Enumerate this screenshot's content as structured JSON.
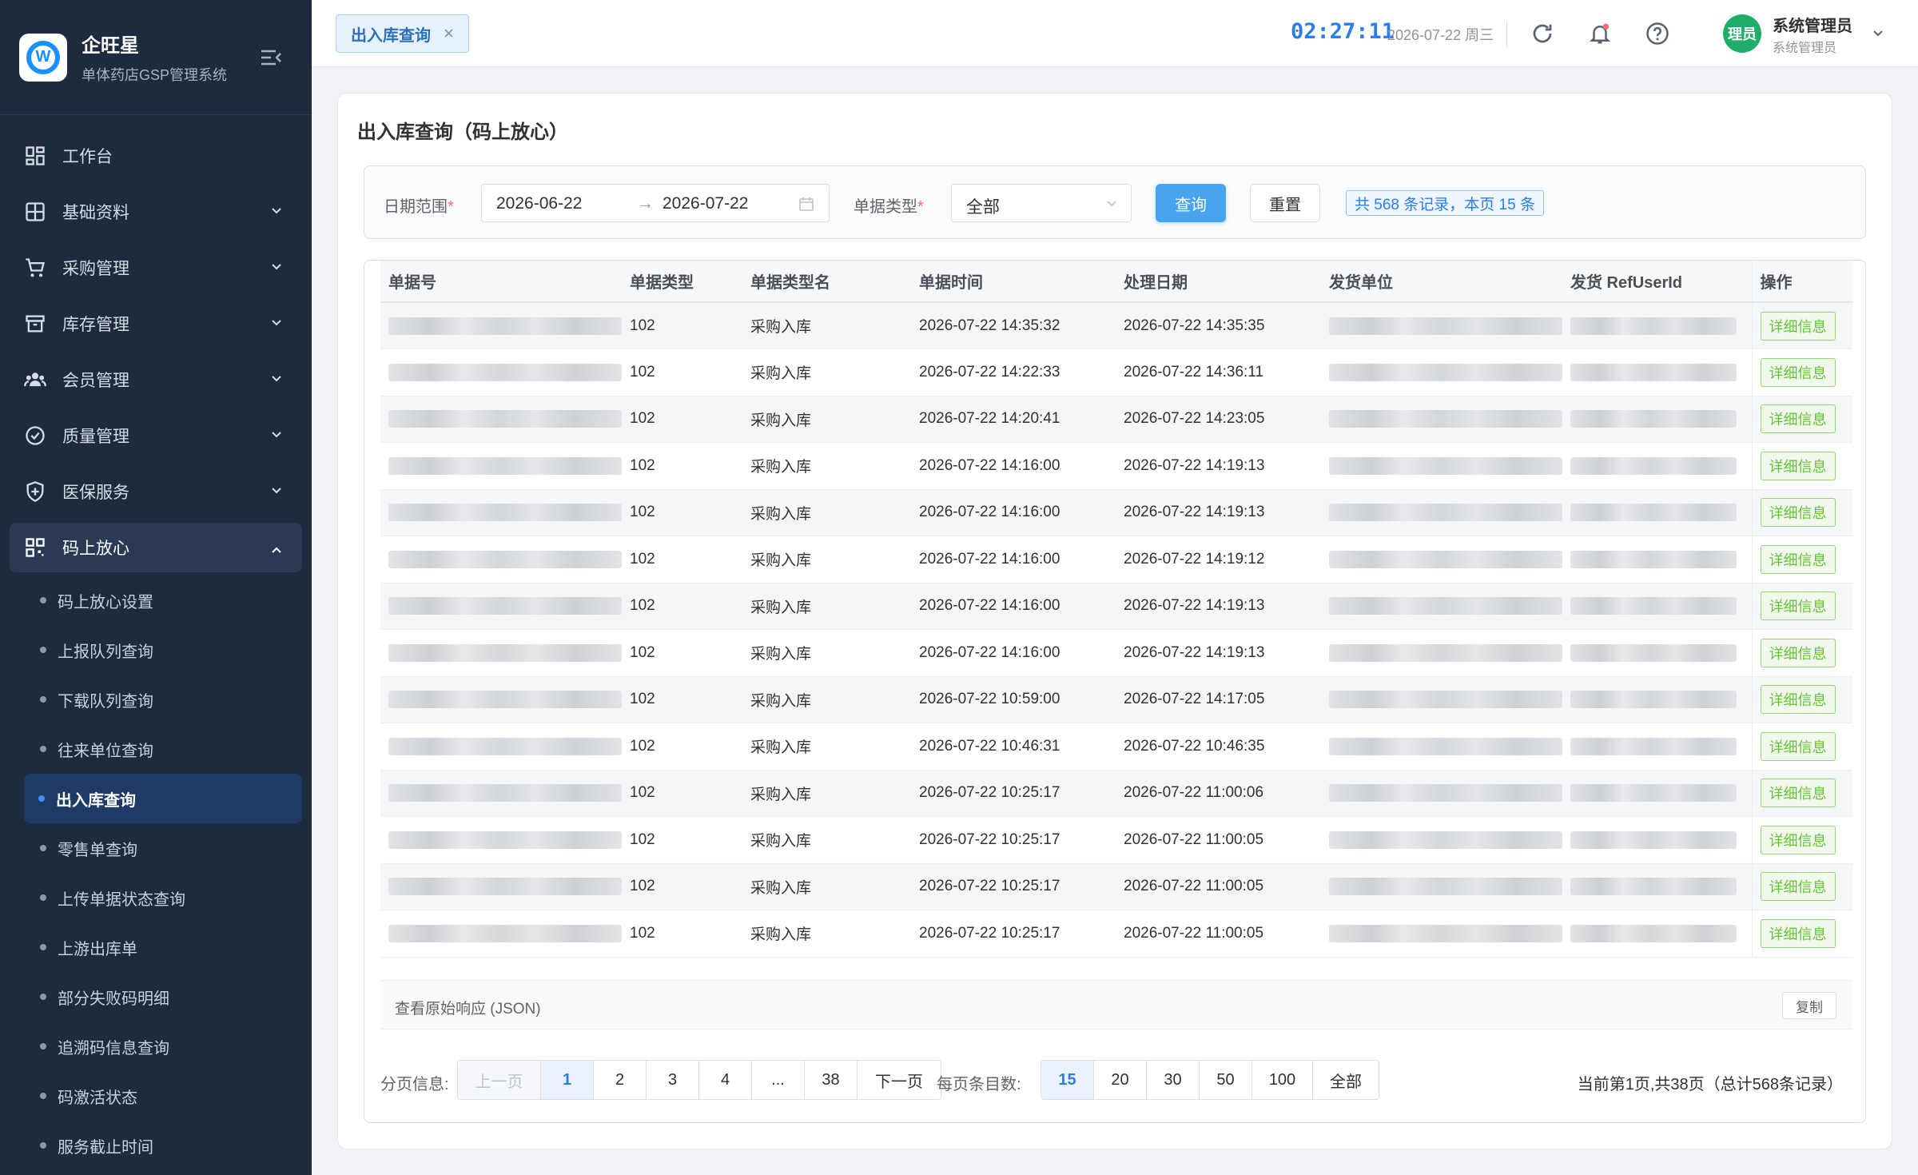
{
  "brand": {
    "name": "企旺星",
    "subtitle": "单体药店GSP管理系统",
    "logo_letter": "W"
  },
  "sidebar": {
    "items": [
      {
        "label": "工作台",
        "icon": "dashboard-icon"
      },
      {
        "label": "基础资料",
        "icon": "grid-icon"
      },
      {
        "label": "采购管理",
        "icon": "cart-icon"
      },
      {
        "label": "库存管理",
        "icon": "box-icon"
      },
      {
        "label": "会员管理",
        "icon": "users-icon"
      },
      {
        "label": "质量管理",
        "icon": "check-circle-icon"
      },
      {
        "label": "医保服务",
        "icon": "shield-icon"
      },
      {
        "label": "码上放心",
        "icon": "qrcode-icon"
      }
    ],
    "subitems": [
      "码上放心设置",
      "上报队列查询",
      "下载队列查询",
      "往来单位查询",
      "出入库查询",
      "零售单查询",
      "上传单据状态查询",
      "上游出库单",
      "部分失败码明细",
      "追溯码信息查询",
      "码激活状态",
      "服务截止时间"
    ]
  },
  "header": {
    "tab_label": "出入库查询",
    "tab_close": "×",
    "clock": "02:27:11",
    "date": "2026-07-22 周三",
    "avatar_text": "理员",
    "user_name": "系统管理员",
    "user_role": "系统管理员"
  },
  "page": {
    "title": "出入库查询（码上放心）"
  },
  "filter": {
    "date_label": "日期范围",
    "required_mark": "*",
    "date_start": "2026-06-22",
    "date_sep": "→",
    "date_end": "2026-07-22",
    "type_label": "单据类型",
    "type_value": "全部",
    "query_btn": "查询",
    "reset_btn": "重置",
    "count_text": "共 568 条记录，本页 15 条"
  },
  "table": {
    "headers": [
      "单据号",
      "单据类型",
      "单据类型名",
      "单据时间",
      "处理日期",
      "发货单位",
      "发货 RefUserId",
      "操作"
    ],
    "detail_label": "详细信息",
    "rows": [
      {
        "type": "102",
        "type_name": "采购入库",
        "time": "2026-07-22 14:35:32",
        "processed": "2026-07-22 14:35:35"
      },
      {
        "type": "102",
        "type_name": "采购入库",
        "time": "2026-07-22 14:22:33",
        "processed": "2026-07-22 14:36:11"
      },
      {
        "type": "102",
        "type_name": "采购入库",
        "time": "2026-07-22 14:20:41",
        "processed": "2026-07-22 14:23:05"
      },
      {
        "type": "102",
        "type_name": "采购入库",
        "time": "2026-07-22 14:16:00",
        "processed": "2026-07-22 14:19:13"
      },
      {
        "type": "102",
        "type_name": "采购入库",
        "time": "2026-07-22 14:16:00",
        "processed": "2026-07-22 14:19:13"
      },
      {
        "type": "102",
        "type_name": "采购入库",
        "time": "2026-07-22 14:16:00",
        "processed": "2026-07-22 14:19:12"
      },
      {
        "type": "102",
        "type_name": "采购入库",
        "time": "2026-07-22 14:16:00",
        "processed": "2026-07-22 14:19:13"
      },
      {
        "type": "102",
        "type_name": "采购入库",
        "time": "2026-07-22 14:16:00",
        "processed": "2026-07-22 14:19:13"
      },
      {
        "type": "102",
        "type_name": "采购入库",
        "time": "2026-07-22 10:59:00",
        "processed": "2026-07-22 14:17:05"
      },
      {
        "type": "102",
        "type_name": "采购入库",
        "time": "2026-07-22 10:46:31",
        "processed": "2026-07-22 10:46:35"
      },
      {
        "type": "102",
        "type_name": "采购入库",
        "time": "2026-07-22 10:25:17",
        "processed": "2026-07-22 11:00:06"
      },
      {
        "type": "102",
        "type_name": "采购入库",
        "time": "2026-07-22 10:25:17",
        "processed": "2026-07-22 11:00:05"
      },
      {
        "type": "102",
        "type_name": "采购入库",
        "time": "2026-07-22 10:25:17",
        "processed": "2026-07-22 11:00:05"
      },
      {
        "type": "102",
        "type_name": "采购入库",
        "time": "2026-07-22 10:25:17",
        "processed": "2026-07-22 11:00:05"
      }
    ]
  },
  "json_panel": {
    "label": "查看原始响应 (JSON)",
    "copy": "复制"
  },
  "pager": {
    "label": "分页信息:",
    "prev": "上一页",
    "pages": [
      "1",
      "2",
      "3",
      "4",
      "...",
      "38"
    ],
    "next": "下一页",
    "size_label": "每页条目数:",
    "sizes": [
      "15",
      "20",
      "30",
      "50",
      "100",
      "全部"
    ],
    "summary": "当前第1页,共38页（总计568条记录）"
  },
  "colors": {
    "accent": "#2b7de9",
    "sidebar_bg": "#1e2a3d",
    "success": "#67c23a"
  }
}
